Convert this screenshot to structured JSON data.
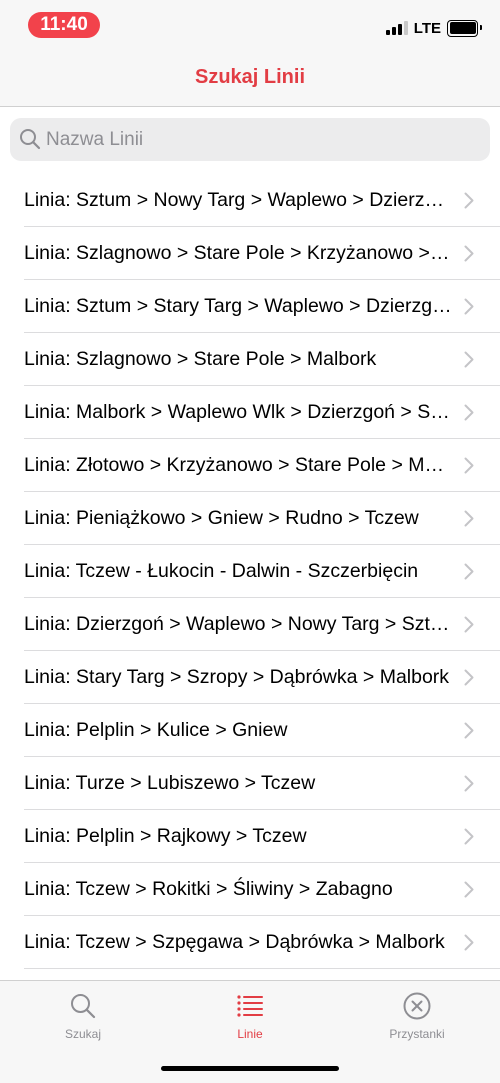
{
  "status": {
    "time": "11:40",
    "network": "LTE",
    "time_pill_color": "#f2424b"
  },
  "nav": {
    "title": "Szukaj Linii"
  },
  "search": {
    "placeholder": "Nazwa Linii",
    "value": ""
  },
  "lines": [
    "Linia: Sztum > Nowy Targ > Waplewo > Dzierzgoń",
    "Linia: Szlagnowo > Stare Pole > Krzyżanowo > Malbork",
    "Linia: Sztum > Stary Targ > Waplewo > Dzierzgoń",
    "Linia: Szlagnowo > Stare Pole > Malbork",
    "Linia: Malbork > Waplewo Wlk > Dzierzgoń > Sztum",
    "Linia: Złotowo > Krzyżanowo > Stare Pole > Malbork",
    "Linia: Pieniążkowo > Gniew > Rudno > Tczew",
    "Linia: Tczew - Łukocin - Dalwin - Szczerbięcin",
    "Linia: Dzierzgoń > Waplewo > Nowy Targ > Sztum",
    "Linia: Stary Targ > Szropy > Dąbrówka > Malbork",
    "Linia: Pelplin > Kulice > Gniew",
    "Linia: Turze > Lubiszewo > Tczew",
    "Linia: Pelplin > Rajkowy > Tczew",
    "Linia: Tczew > Rokitki > Śliwiny > Zabagno",
    "Linia: Tczew > Szpęgawa > Dąbrówka > Malbork"
  ],
  "tabs": [
    {
      "label": "Szukaj",
      "icon": "magnifier-icon",
      "active": false
    },
    {
      "label": "Linie",
      "icon": "list-icon",
      "active": true
    },
    {
      "label": "Przystanki",
      "icon": "close-circle-icon",
      "active": false
    }
  ],
  "colors": {
    "accent": "#e23d44",
    "inactive": "#8e8e93",
    "separator": "#dcdcde"
  }
}
